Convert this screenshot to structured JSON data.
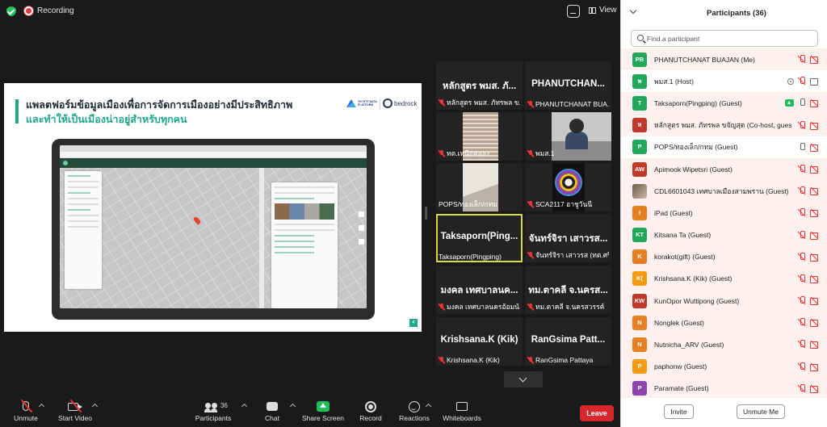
{
  "topbar": {
    "recording_label": "Recording",
    "view_label": "View"
  },
  "slide": {
    "title_line1": "แพลตฟอร์มข้อมูลเมืองเพื่อการจัดการเมืองอย่างมีประสิทธิภาพ",
    "title_line2": "และทำให้เป็นเมืองน่าอยู่สำหรับทุกคน",
    "logo_text": "TH CITY DATA PLATFORM",
    "brand": "bedrock",
    "page": "4"
  },
  "tiles": [
    {
      "big": "หลักสูตร พมส. ภั...",
      "label": "หลักสูตร พมส. ภัทรพล ข...",
      "muted": true
    },
    {
      "big": "PHANUTCHAN...",
      "label": "PHANUTCHANAT BUA...",
      "muted": true
    },
    {
      "big": "",
      "label": "ทต.เหนือคลอง",
      "muted": true
    },
    {
      "big": "",
      "label": "พมส.1",
      "muted": true
    },
    {
      "big": "",
      "label": "POPS/ทองเล็ก/กทม",
      "muted": false
    },
    {
      "big": "",
      "label": "SCA2117 อาชูวันนี",
      "muted": true
    },
    {
      "big": "Taksaporn(Ping...",
      "label": "Taksaporn(Pingping)",
      "muted": false
    },
    {
      "big": "จันทร์จิรา เสาวรส...",
      "label": "จันทร์จิรา เสาวรส (ทต.ศรีด...",
      "muted": true
    },
    {
      "big": "มงคล เทศบาลนค...",
      "label": "มงคล เทศบาลนครอ้อมน้อย",
      "muted": true
    },
    {
      "big": "ทม.ตาคลี จ.นครส...",
      "label": "ทม.ตาคลี จ.นครสวรรค์",
      "muted": true
    },
    {
      "big": "Krishsana.K (Kik)",
      "label": "Krishsana.K (Kik)",
      "muted": true
    },
    {
      "big": "RanGsima Patt...",
      "label": "RanGsima Pattaya",
      "muted": true
    }
  ],
  "toolbar": {
    "unmute": "Unmute",
    "start_video": "Start Video",
    "participants": "Participants",
    "participants_count": "36",
    "chat": "Chat",
    "share_screen": "Share Screen",
    "record": "Record",
    "reactions": "Reactions",
    "whiteboards": "Whiteboards",
    "leave": "Leave"
  },
  "panel": {
    "title": "Participants (36)",
    "search_placeholder": "Find a participant",
    "invite": "Invite",
    "unmute_me": "Unmute Me",
    "participants": [
      {
        "initials": "PB",
        "color": "#22a85a",
        "name": "PHANUTCHANAT BUAJAN (Me)",
        "mic": "off",
        "cam": "off",
        "hl": true
      },
      {
        "initials": "พ",
        "color": "#22a85a",
        "name": "พมส.1 (Host)",
        "mic": "off",
        "cam": "on",
        "ring": true,
        "hl": false
      },
      {
        "initials": "T",
        "color": "#22a85a",
        "name": "Taksaporn(Pingping) (Guest)",
        "mic": "on",
        "cam": "off",
        "share": true,
        "hl": true
      },
      {
        "initials": "ห",
        "color": "#c0392b",
        "name": "หลักสูตร พมส. ภัทรพล ขจัญสุด (Co-host, guest)",
        "mic": "off",
        "cam": "off",
        "hl": true
      },
      {
        "initials": "P",
        "color": "#22a85a",
        "name": "POPS/ทองเล็ก/กทม (Guest)",
        "mic": "on",
        "cam": "off",
        "hl": false
      },
      {
        "initials": "AW",
        "color": "#c0392b",
        "name": "Apimook Wipetsri (Guest)",
        "mic": "off",
        "cam": "off",
        "hl": true
      },
      {
        "initials": "",
        "color": "photo",
        "name": "CDL6601043 เทศบาลเมืองสามพราน (Guest)",
        "mic": "off",
        "cam": "off",
        "hl": true
      },
      {
        "initials": "I",
        "color": "#e67e22",
        "name": "iPad (Guest)",
        "mic": "off",
        "cam": "off",
        "hl": true
      },
      {
        "initials": "KT",
        "color": "#22a85a",
        "name": "Kitsana Ta (Guest)",
        "mic": "off",
        "cam": "off",
        "hl": true
      },
      {
        "initials": "K",
        "color": "#e67e22",
        "name": "korakot(gift) (Guest)",
        "mic": "off",
        "cam": "off",
        "hl": true
      },
      {
        "initials": "K(",
        "color": "#f39c12",
        "name": "Krishsana.K (Kik) (Guest)",
        "mic": "off",
        "cam": "off",
        "hl": true
      },
      {
        "initials": "KW",
        "color": "#c0392b",
        "name": "KunOpor Wuttipong (Guest)",
        "mic": "off",
        "cam": "off",
        "hl": true
      },
      {
        "initials": "N",
        "color": "#e67e22",
        "name": "Nonglek (Guest)",
        "mic": "off",
        "cam": "off",
        "hl": true
      },
      {
        "initials": "N",
        "color": "#e67e22",
        "name": "Nutnicha_ARV (Guest)",
        "mic": "off",
        "cam": "off",
        "hl": true
      },
      {
        "initials": "P",
        "color": "#f39c12",
        "name": "paphonw (Guest)",
        "mic": "off",
        "cam": "off",
        "hl": true
      },
      {
        "initials": "P",
        "color": "#8e44ad",
        "name": "Paramate (Guest)",
        "mic": "off",
        "cam": "off",
        "hl": true
      }
    ]
  }
}
